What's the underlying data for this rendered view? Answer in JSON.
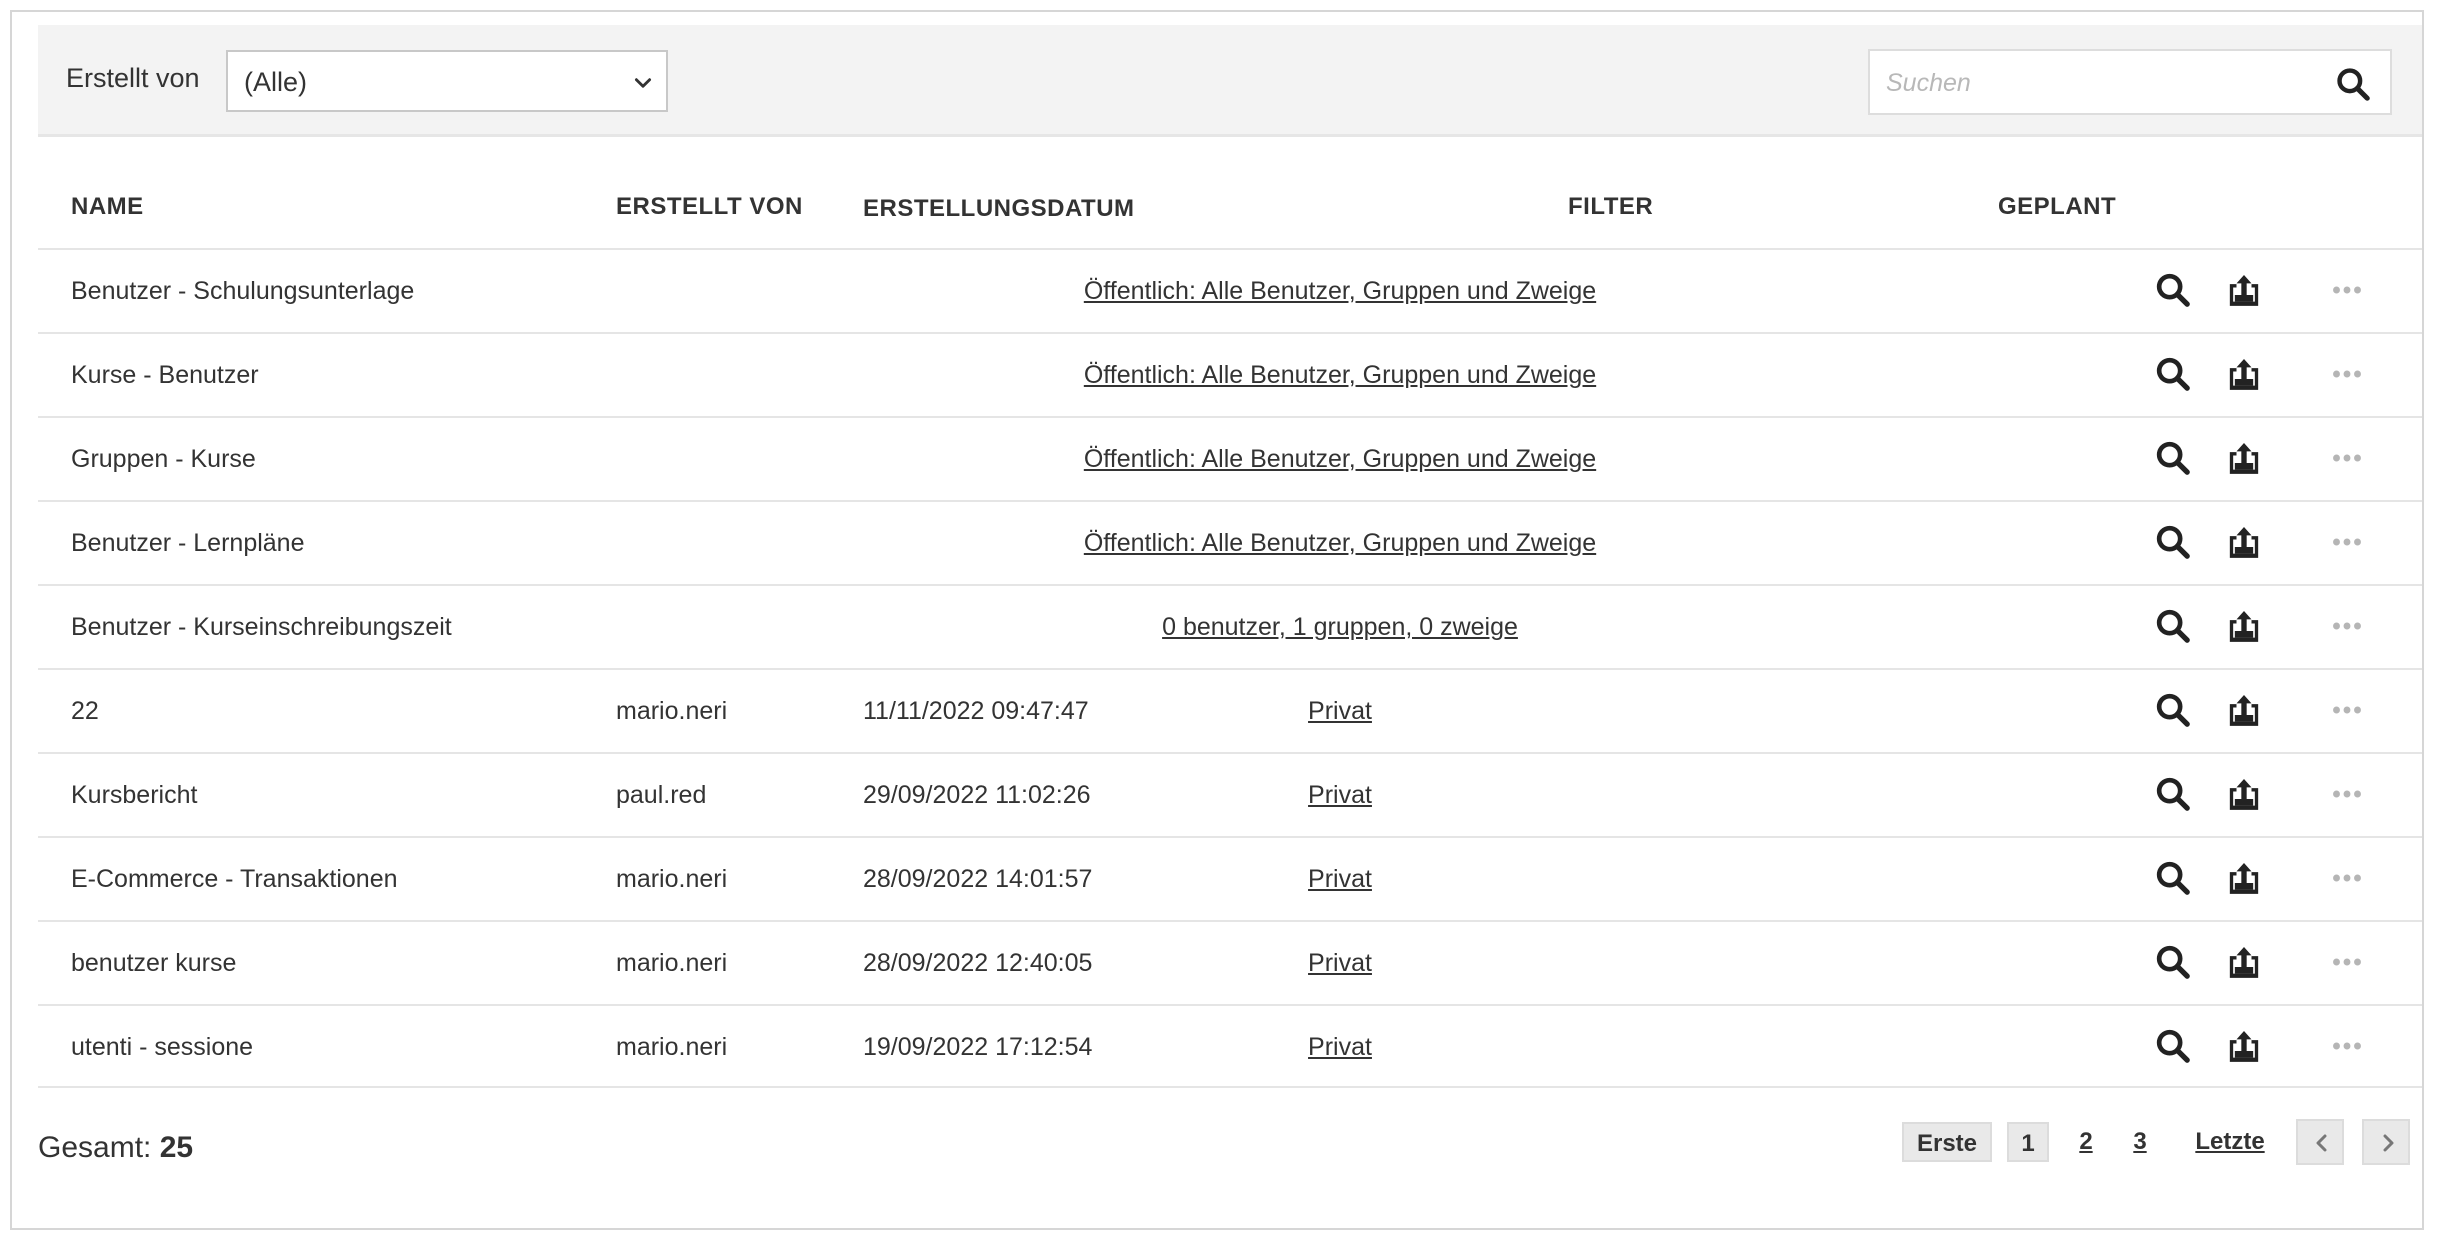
{
  "toolbar": {
    "created_by_label": "Erstellt von",
    "created_by_value": "(Alle)",
    "search_placeholder": "Suchen"
  },
  "table": {
    "columns": [
      "NAME",
      "ERSTELLT VON",
      "ERSTELLUNGSDATUM",
      "FILTER",
      "GEPLANT"
    ],
    "rows": [
      {
        "name": "Benutzer - Schulungsunterlage",
        "created_by": "",
        "created_at": "",
        "filter": "Öffentlich: Alle Benutzer, Gruppen und Zweige",
        "scheduled": ""
      },
      {
        "name": "Kurse - Benutzer",
        "created_by": "",
        "created_at": "",
        "filter": "Öffentlich: Alle Benutzer, Gruppen und Zweige",
        "scheduled": ""
      },
      {
        "name": "Gruppen - Kurse",
        "created_by": "",
        "created_at": "",
        "filter": "Öffentlich: Alle Benutzer, Gruppen und Zweige",
        "scheduled": ""
      },
      {
        "name": "Benutzer - Lernpläne",
        "created_by": "",
        "created_at": "",
        "filter": "Öffentlich: Alle Benutzer, Gruppen und Zweige",
        "scheduled": ""
      },
      {
        "name": "Benutzer - Kurseinschreibungszeit",
        "created_by": "",
        "created_at": "",
        "filter": "0 benutzer, 1 gruppen, 0 zweige",
        "scheduled": ""
      },
      {
        "name": "22",
        "created_by": "mario.neri",
        "created_at": "11/11/2022 09:47:47",
        "filter": "Privat",
        "scheduled": ""
      },
      {
        "name": "Kursbericht",
        "created_by": "paul.red",
        "created_at": "29/09/2022 11:02:26",
        "filter": "Privat",
        "scheduled": ""
      },
      {
        "name": "E-Commerce - Transaktionen",
        "created_by": "mario.neri",
        "created_at": "28/09/2022 14:01:57",
        "filter": "Privat",
        "scheduled": ""
      },
      {
        "name": "benutzer kurse",
        "created_by": "mario.neri",
        "created_at": "28/09/2022 12:40:05",
        "filter": "Privat",
        "scheduled": ""
      },
      {
        "name": "utenti - sessione",
        "created_by": "mario.neri",
        "created_at": "19/09/2022 17:12:54",
        "filter": "Privat",
        "scheduled": ""
      }
    ],
    "row_actions": [
      "magnifier-icon",
      "export-tray-icon",
      "ellipsis-icon"
    ]
  },
  "footer": {
    "total_label": "Gesamt:",
    "total_value": "25",
    "pagination": {
      "first_label": "Erste",
      "pages": [
        "1",
        "2",
        "3"
      ],
      "current_page": "1",
      "last_label": "Letzte"
    }
  },
  "colors": {
    "text": "#333333",
    "toolbar_bg": "#f3f3f3",
    "border": "#e5e5e5",
    "muted_icon": "#b5b5b5"
  }
}
